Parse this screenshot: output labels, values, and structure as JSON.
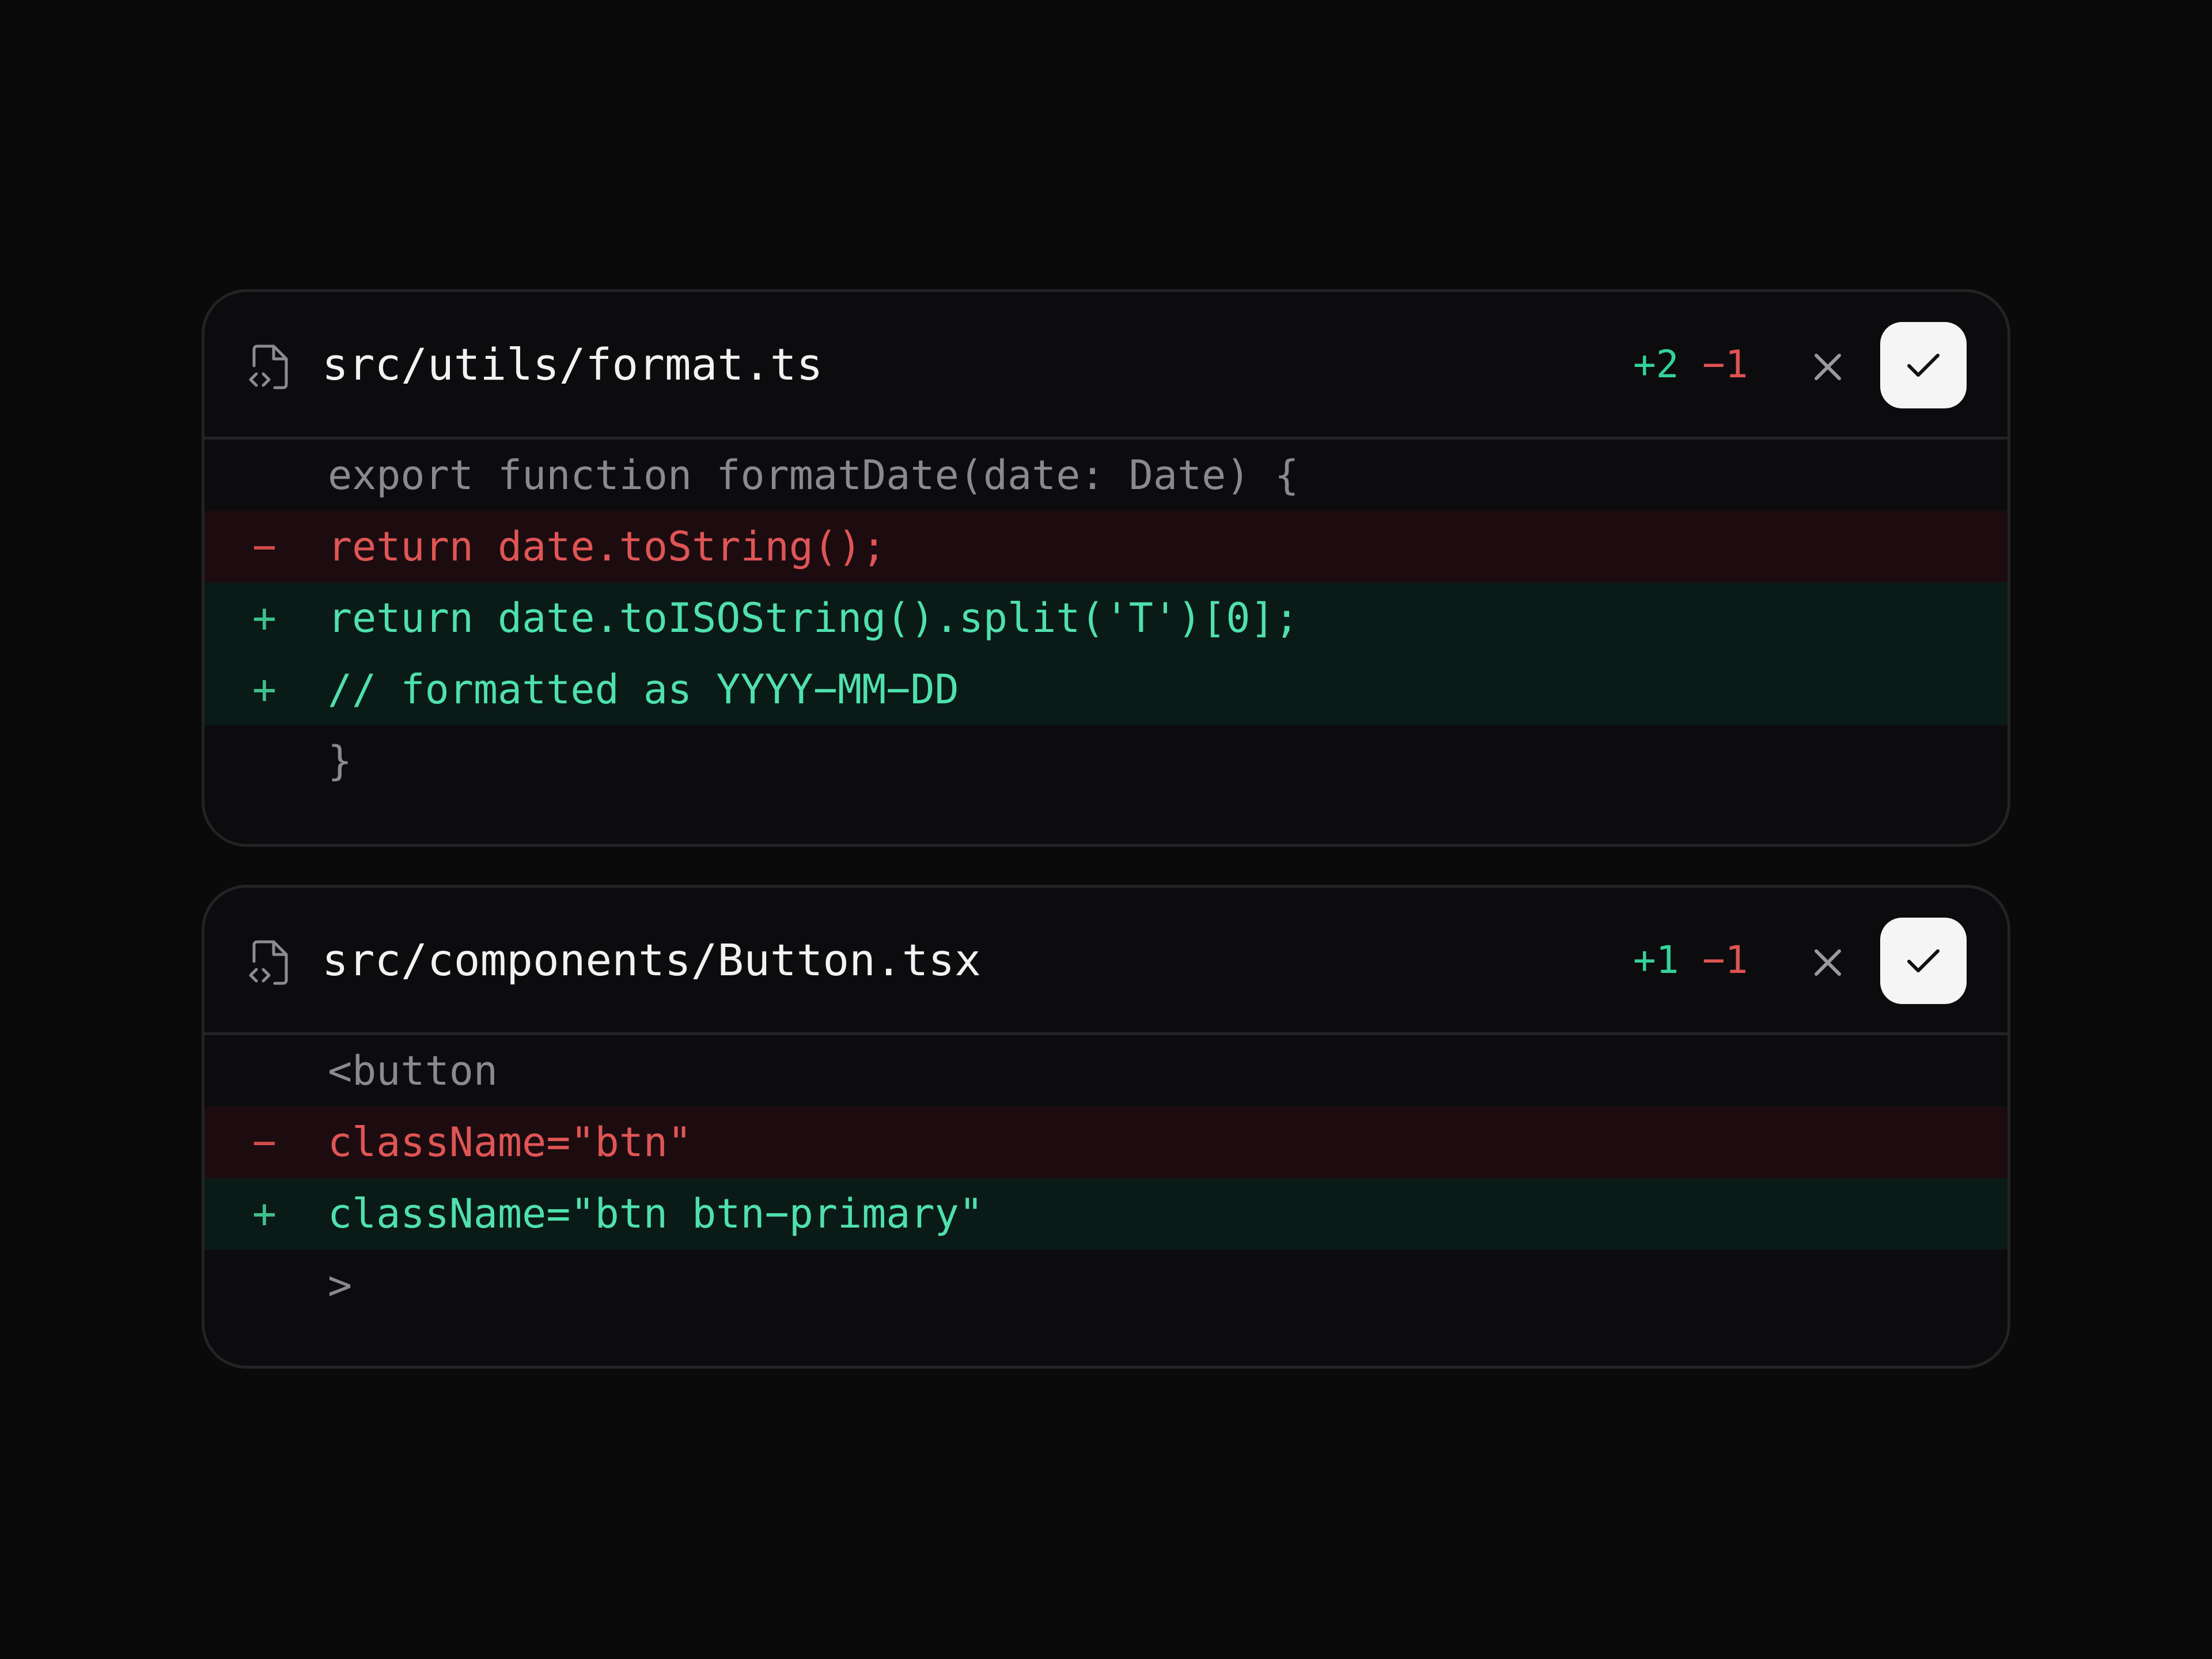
{
  "colors": {
    "background": "#0a0a0a",
    "card": "#0c0c0e",
    "border": "#232325",
    "added": "#34d399",
    "removed": "#e05252",
    "added_bg": "#0a1a17",
    "removed_bg": "#1c0c10"
  },
  "icons": {
    "file": "file-code-icon",
    "reject": "close-icon",
    "accept": "check-icon"
  },
  "files": [
    {
      "name": "src/utils/format.ts",
      "additions": "+2",
      "deletions": "−1",
      "lines": [
        {
          "type": "ctx",
          "marker": "",
          "text": "export function formatDate(date: Date) {"
        },
        {
          "type": "del",
          "marker": "−",
          "text": "return date.toString();"
        },
        {
          "type": "add",
          "marker": "+",
          "text": "return date.toISOString().split('T')[0];"
        },
        {
          "type": "add",
          "marker": "+",
          "text": "// formatted as YYYY−MM−DD"
        },
        {
          "type": "ctx",
          "marker": "",
          "text": "}"
        }
      ]
    },
    {
      "name": "src/components/Button.tsx",
      "additions": "+1",
      "deletions": "−1",
      "lines": [
        {
          "type": "ctx",
          "marker": "",
          "text": "<button"
        },
        {
          "type": "del",
          "marker": "−",
          "text": "className=\"btn\""
        },
        {
          "type": "add",
          "marker": "+",
          "text": "className=\"btn btn−primary\""
        },
        {
          "type": "ctx",
          "marker": "",
          "text": ">"
        }
      ]
    }
  ]
}
